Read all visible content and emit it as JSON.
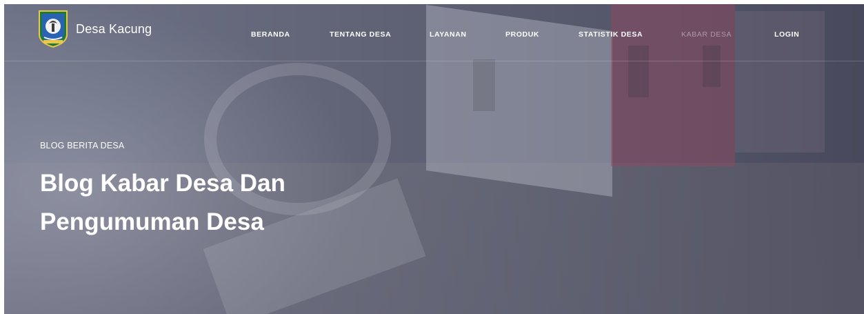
{
  "brand": {
    "name": "Desa Kacung",
    "logo_icon": "regional-emblem-icon"
  },
  "nav": {
    "items": [
      {
        "label": "BERANDA"
      },
      {
        "label": "TENTANG DESA"
      },
      {
        "label": "LAYANAN"
      },
      {
        "label": "PRODUK"
      },
      {
        "label": "STATISTIK DESA"
      },
      {
        "label": "KABAR DESA",
        "active": true
      },
      {
        "label": "LOGIN"
      }
    ]
  },
  "hero": {
    "eyebrow": "BLOG BERITA DESA",
    "title_line1": "Blog Kabar Desa Dan",
    "title_line2": "Pengumuman Desa"
  },
  "colors": {
    "overlay": "#5f6276",
    "text": "#ffffff",
    "active_nav": "#bdb8c8"
  }
}
